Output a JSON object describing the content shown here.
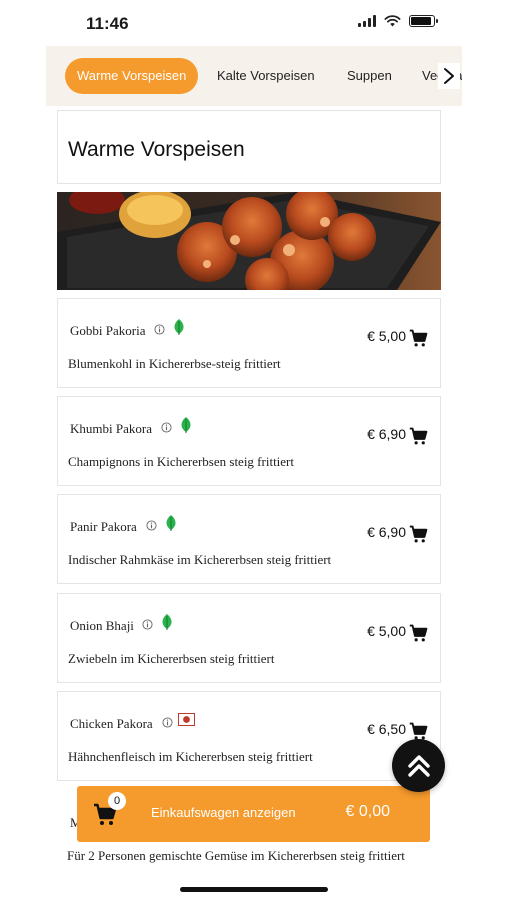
{
  "status_bar": {
    "time": "11:46"
  },
  "categories": {
    "tabs": [
      {
        "label": "Warme Vorspeisen",
        "active": true
      },
      {
        "label": "Kalte Vorspeisen",
        "active": false
      },
      {
        "label": "Suppen",
        "active": false
      },
      {
        "label": "Vegetarische Gerichte",
        "active": false
      }
    ],
    "scroll_icon": "chevron-right-icon"
  },
  "section": {
    "title": "Warme Vorspeisen"
  },
  "items": [
    {
      "name": "Gobbi Pakoria",
      "description": "Blumenkohl in Kichererbse-steig frittiert",
      "price": "€ 5,00",
      "badge": "veg-leaf-icon"
    },
    {
      "name": "Khumbi Pakora",
      "description": "Champignons in Kichererbsen steig frittiert",
      "price": "€ 6,90",
      "badge": "veg-leaf-icon"
    },
    {
      "name": "Panir Pakora",
      "description": "Indischer Rahmkäse im Kichererbsen steig frittiert",
      "price": "€ 6,90",
      "badge": "veg-leaf-icon"
    },
    {
      "name": "Onion Bhaji",
      "description": "Zwiebeln im Kichererbsen steig frittiert",
      "price": "€ 5,00",
      "badge": "veg-leaf-icon"
    },
    {
      "name": "Chicken Pakora",
      "description": "Hähnchenfleisch im Kichererbsen steig frittiert",
      "price": "€ 6,50",
      "badge": "non-veg-icon"
    }
  ],
  "partial_item": {
    "name_fragment": "M",
    "description": "Für 2 Personen gemischte Gemüse im Kichererbsen steig frittiert"
  },
  "cart": {
    "count": "0",
    "label": "Einkaufswagen anzeigen",
    "total": "€ 0,00"
  },
  "colors": {
    "accent": "#f59a2c",
    "veg": "#2bb24c",
    "non_veg": "#c0392b"
  }
}
